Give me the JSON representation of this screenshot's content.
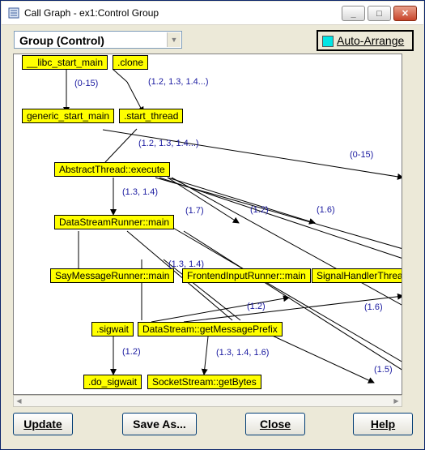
{
  "window": {
    "title": "Call Graph - ex1:Control Group",
    "title_icon": "call-graph-icon",
    "buttons": {
      "minimize": "minimize-icon",
      "maximize": "maximize-icon",
      "close": "close-icon"
    }
  },
  "toolbar": {
    "group_select": "Group (Control)",
    "auto_arrange": {
      "label": "Auto-Arrange",
      "checked": true
    }
  },
  "graph": {
    "nodes": [
      {
        "id": "libc",
        "label": "__libc_start_main"
      },
      {
        "id": "clone",
        "label": ".clone"
      },
      {
        "id": "generic",
        "label": "generic_start_main"
      },
      {
        "id": "start_thread",
        "label": ".start_thread"
      },
      {
        "id": "abstract",
        "label": "AbstractThread::execute"
      },
      {
        "id": "dsr",
        "label": "DataStreamRunner::main"
      },
      {
        "id": "smr",
        "label": "SayMessageRunner::main"
      },
      {
        "id": "fir",
        "label": "FrontendInputRunner::main"
      },
      {
        "id": "shr",
        "label": "SignalHandlerThrea"
      },
      {
        "id": "sigwait",
        "label": ".sigwait"
      },
      {
        "id": "dsgmp",
        "label": "DataStream::getMessagePrefix"
      },
      {
        "id": "dosigwait",
        "label": ".do_sigwait"
      },
      {
        "id": "ssgb",
        "label": "SocketStream::getBytes"
      }
    ],
    "edge_labels": [
      {
        "id": "e1",
        "text": "(0-15)"
      },
      {
        "id": "e2",
        "text": "(1.2, 1.3, 1.4...)"
      },
      {
        "id": "e3",
        "text": "(1.2, 1.3, 1.4...)"
      },
      {
        "id": "e4",
        "text": "(0-15)"
      },
      {
        "id": "e5",
        "text": "(1.3, 1.4)"
      },
      {
        "id": "e6",
        "text": "(1.7)"
      },
      {
        "id": "e7",
        "text": "(1.2)"
      },
      {
        "id": "e8",
        "text": "(1.6)"
      },
      {
        "id": "e9",
        "text": "(1.3, 1.4)"
      },
      {
        "id": "e10",
        "text": "(1.2)"
      },
      {
        "id": "e11",
        "text": "(1.6)"
      },
      {
        "id": "e12",
        "text": "(1.2)"
      },
      {
        "id": "e13",
        "text": "(1.3, 1.4, 1.6)"
      },
      {
        "id": "e14",
        "text": "(1.5)"
      }
    ]
  },
  "footer": {
    "update": "Update",
    "save_as": "Save As...",
    "close": "Close",
    "help": "Help"
  },
  "colors": {
    "node_fill": "#ffff00",
    "edge_label": "#1a1aa0",
    "checkbox": "#00e5e5"
  }
}
